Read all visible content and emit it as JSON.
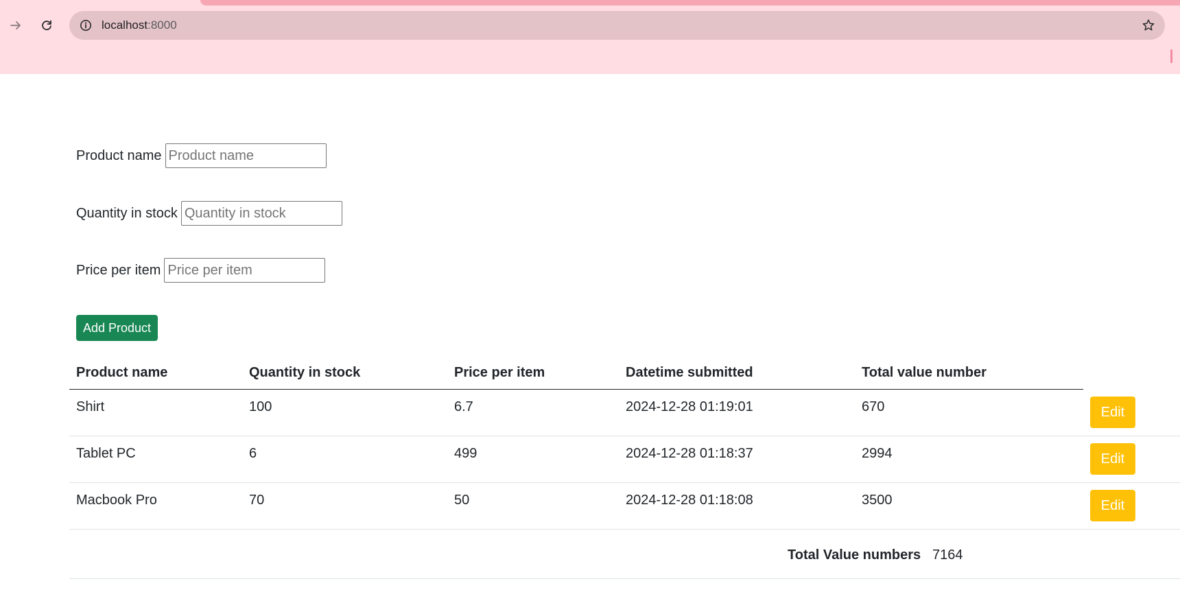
{
  "browser": {
    "url_host": "localhost",
    "url_port": ":8000"
  },
  "icons": {
    "forward": "arrow-forward-icon",
    "reload": "reload-icon",
    "site_info": "info-icon",
    "bookmark": "star-icon"
  },
  "colors": {
    "chrome_bg": "#ffdde3",
    "omnibox_bg": "#e3c2c8",
    "add_button": "#198754",
    "edit_button": "#ffc107"
  },
  "form": {
    "name_label": "Product name",
    "name_placeholder": "Product name",
    "qty_label": "Quantity in stock",
    "qty_placeholder": "Quantity in stock",
    "price_label": "Price per item",
    "price_placeholder": "Price per item",
    "submit_label": "Add Product"
  },
  "table": {
    "headers": [
      "Product name",
      "Quantity in stock",
      "Price per item",
      "Datetime submitted",
      "Total value number"
    ],
    "rows": [
      {
        "name": "Shirt",
        "qty": "100",
        "price": "6.7",
        "datetime": "2024-12-28 01:19:01",
        "total": "670",
        "action": "Edit"
      },
      {
        "name": "Tablet PC",
        "qty": "6",
        "price": "499",
        "datetime": "2024-12-28 01:18:37",
        "total": "2994",
        "action": "Edit"
      },
      {
        "name": "Macbook Pro",
        "qty": "70",
        "price": "50",
        "datetime": "2024-12-28 01:18:08",
        "total": "3500",
        "action": "Edit"
      }
    ],
    "total_label": "Total Value numbers",
    "total_value": "7164"
  }
}
